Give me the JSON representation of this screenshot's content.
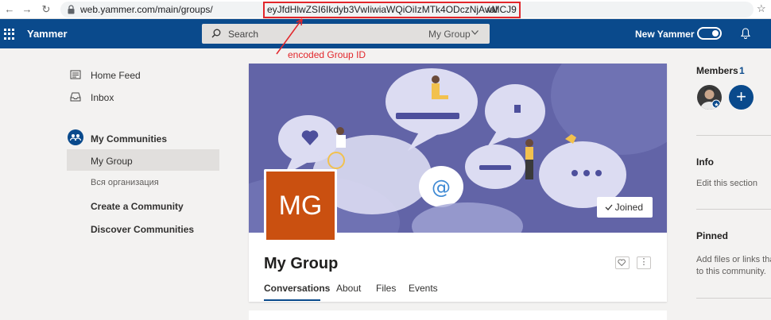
{
  "browser": {
    "url_host": "web.yammer.com/main/groups/",
    "url_group_id": "eyJfdHlwZSI6Ikdyb3VwIiwiaWQiOiIzMTk4ODczNjAwMCJ9",
    "url_tail": "/all"
  },
  "header": {
    "brand": "Yammer",
    "search_placeholder": "Search",
    "search_scope": "My Group",
    "new_yammer_label": "New Yammer"
  },
  "annotation": {
    "text": "encoded Group ID",
    "color": "#e2262b"
  },
  "left_nav": {
    "home_feed": "Home Feed",
    "inbox": "Inbox",
    "my_communities": "My Communities",
    "my_group": "My Group",
    "all_company": "Вся организация",
    "create_community": "Create a Community",
    "discover_communities": "Discover Communities"
  },
  "group": {
    "initials": "MG",
    "name": "My Group",
    "joined_label": "Joined",
    "more_label": "⋮",
    "avatar_color": "#ca5010",
    "banner_color": "#6264a7",
    "tabs": [
      "Conversations",
      "About",
      "Files",
      "Events"
    ],
    "active_tab": "Conversations"
  },
  "right_col": {
    "members_label": "Members",
    "members_count": "1",
    "add_label": "+",
    "info_title": "Info",
    "info_text": "Edit this section",
    "pinned_title": "Pinned",
    "pinned_text_line1": "Add files or links tha",
    "pinned_text_line2": "to this community."
  },
  "colors": {
    "brand": "#0a4a8c",
    "page_bg": "#f3f2f1"
  }
}
